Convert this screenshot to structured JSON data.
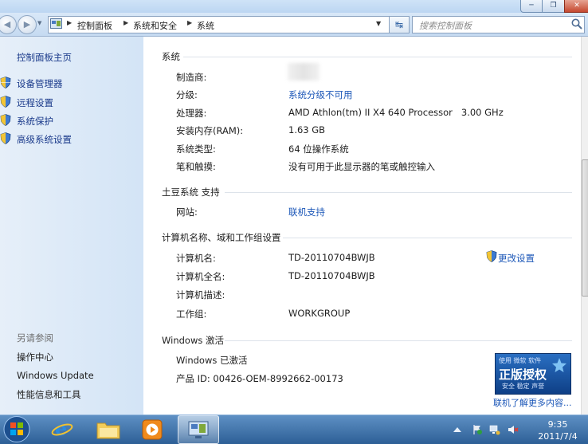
{
  "address_bar": {
    "crumbs": [
      "控制面板",
      "系统和安全",
      "系统"
    ],
    "search_placeholder": "搜索控制面板"
  },
  "sidebar": {
    "home": "控制面板主页",
    "items": [
      {
        "label": "设备管理器",
        "icon": "shield-icon"
      },
      {
        "label": "远程设置",
        "icon": "shield-icon"
      },
      {
        "label": "系统保护",
        "icon": "shield-icon"
      },
      {
        "label": "高级系统设置",
        "icon": "shield-icon"
      }
    ],
    "see_also_title": "另请参阅",
    "see_also": [
      "操作中心",
      "Windows Update",
      "性能信息和工具"
    ]
  },
  "system": {
    "title": "系统",
    "rows": [
      {
        "label": "制造商:",
        "value": ""
      },
      {
        "label": "分级:",
        "value": "系统分级不可用"
      },
      {
        "label": "处理器:",
        "value": "AMD Athlon(tm) II X4 640 Processor   3.00 GHz"
      },
      {
        "label": "安装内存(RAM):",
        "value": "1.63 GB"
      },
      {
        "label": "系统类型:",
        "value": "64 位操作系统"
      },
      {
        "label": "笔和触摸:",
        "value": "没有可用于此显示器的笔或触控输入"
      }
    ]
  },
  "support": {
    "title": "土豆系统 支持",
    "rows": [
      {
        "label": "网站:",
        "value": "联机支持"
      }
    ]
  },
  "computer": {
    "title": "计算机名称、域和工作组设置",
    "change_settings": "更改设置",
    "rows": [
      {
        "label": "计算机名:",
        "value": "TD-20110704BWJB"
      },
      {
        "label": "计算机全名:",
        "value": "TD-20110704BWJB"
      },
      {
        "label": "计算机描述:",
        "value": ""
      },
      {
        "label": "工作组:",
        "value": "WORKGROUP"
      }
    ]
  },
  "activation": {
    "title": "Windows 激活",
    "status": "Windows 已激活",
    "product_id": "产品 ID: 00426-OEM-8992662-00173",
    "badge_top": "使用 微软 软件",
    "badge_main": "正版授权",
    "badge_sub": "安全 稳定 声誉",
    "learn_more": "联机了解更多内容..."
  },
  "taskbar": {
    "time": "9:35",
    "date": "2011/7/4"
  },
  "colors": {
    "link": "#1c57b8",
    "sidebar_link": "#19398a",
    "sidebar_bg": "#dce9f7",
    "taskbar": "#3a6ea5"
  }
}
